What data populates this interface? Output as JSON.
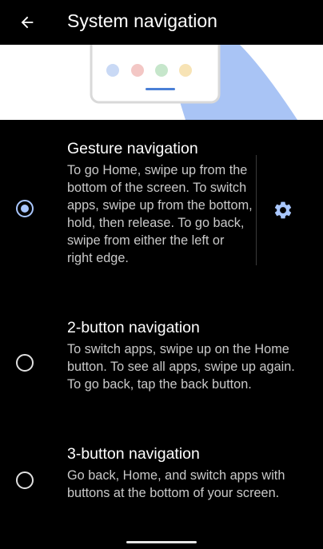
{
  "header": {
    "title": "System navigation"
  },
  "illustration": {
    "dot_colors": [
      "#c9d9f5",
      "#f3c7c5",
      "#c6e6cb",
      "#f7e3b5"
    ],
    "accent": "#a9c4f5"
  },
  "options": [
    {
      "title": "Gesture navigation",
      "description": "To go Home, swipe up from the bottom of the screen. To switch apps, swipe up from the bottom, hold, then release. To go back, swipe from either the left or right edge.",
      "selected": true
    },
    {
      "title": "2-button navigation",
      "description": "To switch apps, swipe up on the Home button. To see all apps, swipe up again. To go back, tap the back button.",
      "selected": false
    },
    {
      "title": "3-button navigation",
      "description": "Go back, Home, and switch apps with buttons at the bottom of your screen.",
      "selected": false
    }
  ],
  "icons": {
    "back": "arrow-back-icon",
    "settings": "gear-icon"
  },
  "colors": {
    "accent": "#a9c7ff",
    "background": "#000000",
    "secondary_text": "#c9c9c9"
  }
}
